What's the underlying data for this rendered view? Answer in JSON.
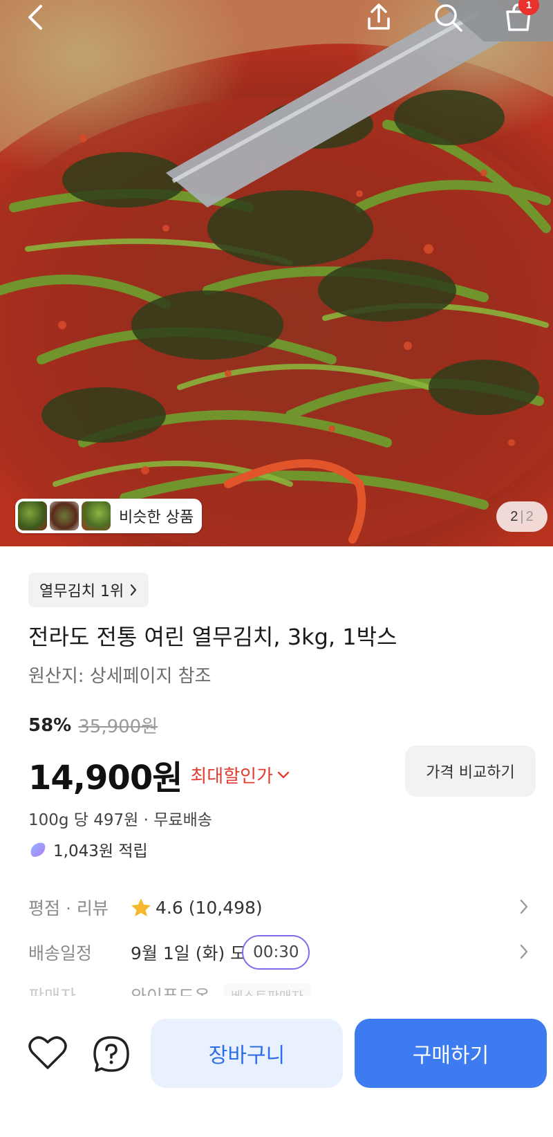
{
  "header": {
    "back_icon": "chevron-left-icon",
    "share_icon": "share-icon",
    "search_icon": "search-icon",
    "cart_icon": "shopping-bag-icon",
    "cart_badge_count": "1"
  },
  "gallery": {
    "similar_label": "비슷한 상품",
    "current_page": "2",
    "separator": "|",
    "total_pages": "2"
  },
  "product": {
    "rank_label": "열무김치 1위",
    "title": "전라도 전통 여린 열무김치, 3kg, 1박스",
    "origin": "원산지: 상세페이지 참조",
    "discount_rate": "58%",
    "original_price": "35,900원",
    "price": "14,900원",
    "max_discount_label": "최대할인가",
    "compare_button": "가격 비교하기",
    "unit_price": "100g 당 497원 · 무료배송",
    "points": "1,043원 적립"
  },
  "info_rows": {
    "rating_label": "평점 · 리뷰",
    "rating_value": "4.6 (10,498)",
    "delivery_label": "배송일정",
    "delivery_value": "9월 1일 (화) 도",
    "delivery_timer": "00:30",
    "seller_label": "판매자",
    "seller_value": "와이푸드온",
    "seller_tag": "베스트판매자"
  },
  "bottom_bar": {
    "cart_button": "장바구니",
    "buy_button": "구매하기"
  },
  "colors": {
    "accent_blue": "#3d7bf0",
    "discount_red": "#e33b2e",
    "badge_red": "#e8322b",
    "star_yellow": "#f5b82e"
  }
}
